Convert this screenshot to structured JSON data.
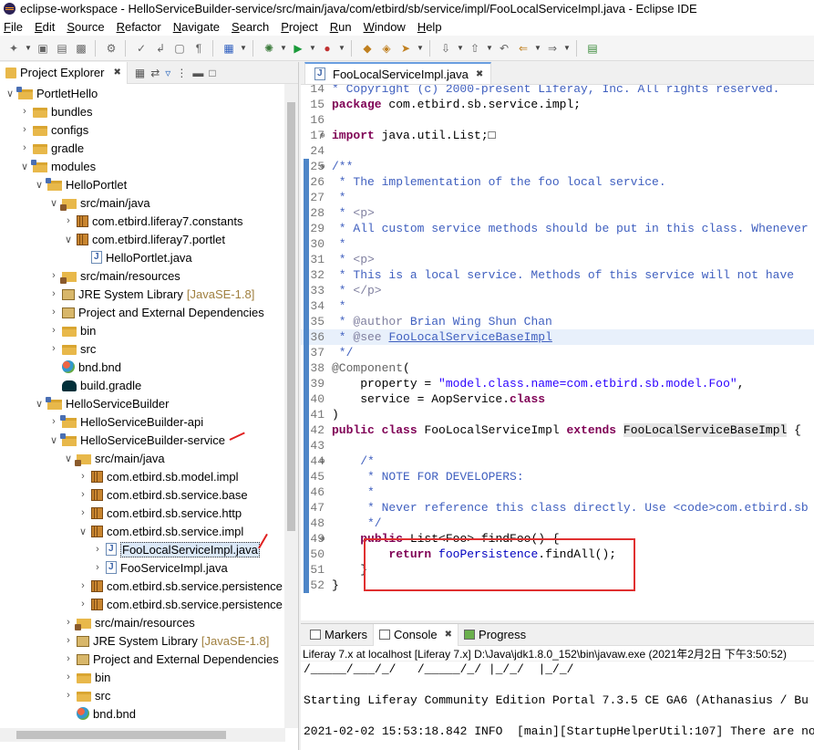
{
  "window": {
    "title": "eclipse-workspace - HelloServiceBuilder-service/src/main/java/com/etbird/sb/service/impl/FooLocalServiceImpl.java - Eclipse IDE"
  },
  "menu": [
    "File",
    "Edit",
    "Source",
    "Refactor",
    "Navigate",
    "Search",
    "Project",
    "Run",
    "Window",
    "Help"
  ],
  "explorer": {
    "tab_label": "Project Explorer",
    "close_glyph": "✖",
    "items": [
      {
        "depth": 0,
        "open": true,
        "icon": "proj",
        "label": "PortletHello",
        "muted": ""
      },
      {
        "depth": 1,
        "open": false,
        "icon": "folder",
        "label": "bundles",
        "muted": ""
      },
      {
        "depth": 1,
        "open": false,
        "icon": "folder",
        "label": "configs",
        "muted": ""
      },
      {
        "depth": 1,
        "open": false,
        "icon": "folder",
        "label": "gradle",
        "muted": ""
      },
      {
        "depth": 1,
        "open": true,
        "icon": "proj",
        "label": "modules",
        "muted": ""
      },
      {
        "depth": 2,
        "open": true,
        "icon": "proj",
        "label": "HelloPortlet",
        "muted": ""
      },
      {
        "depth": 3,
        "open": true,
        "icon": "srcf",
        "label": "src/main/java",
        "muted": ""
      },
      {
        "depth": 4,
        "open": false,
        "icon": "pkg",
        "label": "com.etbird.liferay7.constants",
        "muted": ""
      },
      {
        "depth": 4,
        "open": true,
        "icon": "pkg",
        "label": "com.etbird.liferay7.portlet",
        "muted": ""
      },
      {
        "depth": 5,
        "open": null,
        "icon": "jfile",
        "label": "HelloPortlet.java",
        "muted": ""
      },
      {
        "depth": 3,
        "open": false,
        "icon": "srcf",
        "label": "src/main/resources",
        "muted": ""
      },
      {
        "depth": 3,
        "open": false,
        "icon": "lib",
        "label": "JRE System Library",
        "muted": "[JavaSE-1.8]"
      },
      {
        "depth": 3,
        "open": false,
        "icon": "lib",
        "label": "Project and External Dependencies",
        "muted": ""
      },
      {
        "depth": 3,
        "open": false,
        "icon": "folder",
        "label": "bin",
        "muted": ""
      },
      {
        "depth": 3,
        "open": false,
        "icon": "folder",
        "label": "src",
        "muted": ""
      },
      {
        "depth": 3,
        "open": null,
        "icon": "bnd",
        "label": "bnd.bnd",
        "muted": ""
      },
      {
        "depth": 3,
        "open": null,
        "icon": "grad",
        "label": "build.gradle",
        "muted": ""
      },
      {
        "depth": 2,
        "open": true,
        "icon": "proj",
        "label": "HelloServiceBuilder",
        "muted": ""
      },
      {
        "depth": 3,
        "open": false,
        "icon": "proj",
        "label": "HelloServiceBuilder-api",
        "muted": ""
      },
      {
        "depth": 3,
        "open": true,
        "icon": "proj",
        "label": "HelloServiceBuilder-service",
        "muted": ""
      },
      {
        "depth": 4,
        "open": true,
        "icon": "srcf",
        "label": "src/main/java",
        "muted": ""
      },
      {
        "depth": 5,
        "open": false,
        "icon": "pkg",
        "label": "com.etbird.sb.model.impl",
        "muted": ""
      },
      {
        "depth": 5,
        "open": false,
        "icon": "pkg",
        "label": "com.etbird.sb.service.base",
        "muted": ""
      },
      {
        "depth": 5,
        "open": false,
        "icon": "pkg",
        "label": "com.etbird.sb.service.http",
        "muted": ""
      },
      {
        "depth": 5,
        "open": true,
        "icon": "pkg",
        "label": "com.etbird.sb.service.impl",
        "muted": ""
      },
      {
        "depth": 6,
        "open": false,
        "icon": "jfile",
        "label": "FooLocalServiceImpl.java",
        "muted": "",
        "selected": true
      },
      {
        "depth": 6,
        "open": false,
        "icon": "jfile",
        "label": "FooServiceImpl.java",
        "muted": ""
      },
      {
        "depth": 5,
        "open": false,
        "icon": "pkg",
        "label": "com.etbird.sb.service.persistence",
        "muted": ""
      },
      {
        "depth": 5,
        "open": false,
        "icon": "pkg",
        "label": "com.etbird.sb.service.persistence",
        "muted": ""
      },
      {
        "depth": 4,
        "open": false,
        "icon": "srcf",
        "label": "src/main/resources",
        "muted": ""
      },
      {
        "depth": 4,
        "open": false,
        "icon": "lib",
        "label": "JRE System Library",
        "muted": "[JavaSE-1.8]"
      },
      {
        "depth": 4,
        "open": false,
        "icon": "lib",
        "label": "Project and External Dependencies",
        "muted": ""
      },
      {
        "depth": 4,
        "open": false,
        "icon": "folder",
        "label": "bin",
        "muted": ""
      },
      {
        "depth": 4,
        "open": false,
        "icon": "folder",
        "label": "src",
        "muted": ""
      },
      {
        "depth": 4,
        "open": null,
        "icon": "bnd",
        "label": "bnd.bnd",
        "muted": ""
      }
    ]
  },
  "editor": {
    "tab_label": "FooLocalServiceImpl.java",
    "close_glyph": "✖",
    "lines": [
      {
        "n": "14",
        "html": "<span class='cm'>* Copyright (c) 2000-present Liferay, Inc. All rights reserved.</span>",
        "marker": false
      },
      {
        "n": "15",
        "html": "<span class='kw'>package</span> com.etbird.sb.service.impl;",
        "marker": false
      },
      {
        "n": "16",
        "html": "",
        "marker": false
      },
      {
        "n": "17",
        "html": "<span class='kw'>import</span> java.util.List;&#9633;",
        "marker": false,
        "plus": true
      },
      {
        "n": "24",
        "html": "",
        "marker": false
      },
      {
        "n": "25",
        "html": "<span class='cm'>/**</span>",
        "marker": true,
        "plus": true
      },
      {
        "n": "26",
        "html": "<span class='cm'> * The implementation of the foo local service.</span>",
        "marker": true
      },
      {
        "n": "27",
        "html": "<span class='cm'> *</span>",
        "marker": true
      },
      {
        "n": "28",
        "html": "<span class='cm'> * <span class='tag'>&lt;p&gt;</span></span>",
        "marker": true
      },
      {
        "n": "29",
        "html": "<span class='cm'> * All custom service methods should be put in this class. Whenever</span>",
        "marker": true
      },
      {
        "n": "30",
        "html": "<span class='cm'> *</span>",
        "marker": true
      },
      {
        "n": "31",
        "html": "<span class='cm'> * <span class='tag'>&lt;p&gt;</span></span>",
        "marker": true
      },
      {
        "n": "32",
        "html": "<span class='cm'> * This is a local service. Methods of this service will not have</span>",
        "marker": true
      },
      {
        "n": "33",
        "html": "<span class='cm'> * <span class='tag'>&lt;/p&gt;</span></span>",
        "marker": true
      },
      {
        "n": "34",
        "html": "<span class='cm'> *</span>",
        "marker": true
      },
      {
        "n": "35",
        "html": "<span class='cm'> * <span class='tag'>@author</span> Brian Wing Shun Chan</span>",
        "marker": true
      },
      {
        "n": "36",
        "html": "<span class='cm'> * <span class='tag'>@see</span> <u>FooLocalServiceBaseImpl</u></span>",
        "marker": true,
        "hl": true
      },
      {
        "n": "37",
        "html": "<span class='cm'> */</span>",
        "marker": true
      },
      {
        "n": "38",
        "html": "<span class='an'>@Component</span>(",
        "marker": true
      },
      {
        "n": "39",
        "html": "    property = <span class='st'>\"model.class.name=com.etbird.sb.model.Foo\"</span>,",
        "marker": true
      },
      {
        "n": "40",
        "html": "    service = AopService.<span class='kw'>class</span>",
        "marker": true
      },
      {
        "n": "41",
        "html": ")",
        "marker": true
      },
      {
        "n": "42",
        "html": "<span class='kw'>public</span> <span class='kw'>class</span> FooLocalServiceImpl <span class='kw'>extends</span> <span style='background:#e4e4e4'>FooLocalServiceBaseImpl</span> {",
        "marker": true
      },
      {
        "n": "43",
        "html": "",
        "marker": true
      },
      {
        "n": "44",
        "html": "    <span class='cm'>/*</span>",
        "marker": true,
        "plus": true
      },
      {
        "n": "45",
        "html": "<span class='cm'>     * NOTE FOR DEVELOPERS:</span>",
        "marker": true
      },
      {
        "n": "46",
        "html": "<span class='cm'>     *</span>",
        "marker": true
      },
      {
        "n": "47",
        "html": "<span class='cm'>     * Never reference this class directly. Use &lt;code&gt;com.etbird.sb</span>",
        "marker": true
      },
      {
        "n": "48",
        "html": "<span class='cm'>     */</span>",
        "marker": true
      },
      {
        "n": "49",
        "html": "    <span class='kw'>public</span> List&lt;Foo&gt; findFoo() {",
        "marker": true,
        "plus": true
      },
      {
        "n": "50",
        "html": "        <span class='kw'>return</span> <span class='fd'>fooPersistence</span>.findAll();",
        "marker": true
      },
      {
        "n": "51",
        "html": "    }",
        "marker": true
      },
      {
        "n": "52",
        "html": "}",
        "marker": true
      }
    ]
  },
  "bottom": {
    "tabs": [
      {
        "label": "Markers",
        "active": false
      },
      {
        "label": "Console",
        "active": true
      },
      {
        "label": "Progress",
        "active": false
      }
    ],
    "console_header": "Liferay 7.x at localhost [Liferay 7.x] D:\\Java\\jdk1.8.0_152\\bin\\javaw.exe  (2021年2月2日 下午3:50:52)",
    "console_lines": [
      "/_____/___/_/   /_____/_/ |_/_/  |_/_/",
      "",
      "Starting Liferay Community Edition Portal 7.3.5 CE GA6 (Athanasius / Bu",
      "",
      "2021-02-02 15:53:18.842 INFO  [main][StartupHelperUtil:107] There are no"
    ]
  }
}
